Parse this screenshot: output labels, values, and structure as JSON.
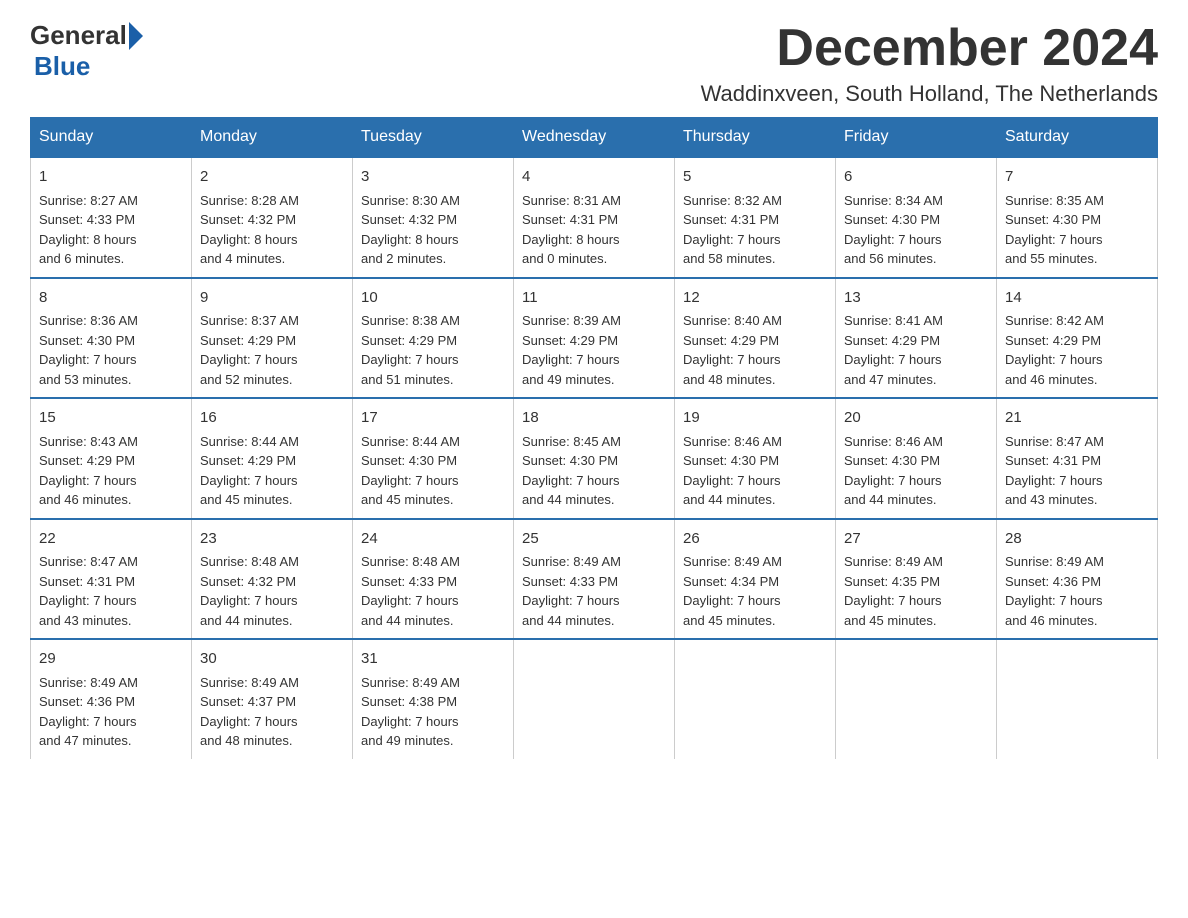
{
  "logo": {
    "general": "General",
    "blue": "Blue"
  },
  "title": "December 2024",
  "location": "Waddinxveen, South Holland, The Netherlands",
  "days_of_week": [
    "Sunday",
    "Monday",
    "Tuesday",
    "Wednesday",
    "Thursday",
    "Friday",
    "Saturday"
  ],
  "weeks": [
    [
      {
        "day": "1",
        "sunrise": "8:27 AM",
        "sunset": "4:33 PM",
        "daylight": "8 hours and 6 minutes."
      },
      {
        "day": "2",
        "sunrise": "8:28 AM",
        "sunset": "4:32 PM",
        "daylight": "8 hours and 4 minutes."
      },
      {
        "day": "3",
        "sunrise": "8:30 AM",
        "sunset": "4:32 PM",
        "daylight": "8 hours and 2 minutes."
      },
      {
        "day": "4",
        "sunrise": "8:31 AM",
        "sunset": "4:31 PM",
        "daylight": "8 hours and 0 minutes."
      },
      {
        "day": "5",
        "sunrise": "8:32 AM",
        "sunset": "4:31 PM",
        "daylight": "7 hours and 58 minutes."
      },
      {
        "day": "6",
        "sunrise": "8:34 AM",
        "sunset": "4:30 PM",
        "daylight": "7 hours and 56 minutes."
      },
      {
        "day": "7",
        "sunrise": "8:35 AM",
        "sunset": "4:30 PM",
        "daylight": "7 hours and 55 minutes."
      }
    ],
    [
      {
        "day": "8",
        "sunrise": "8:36 AM",
        "sunset": "4:30 PM",
        "daylight": "7 hours and 53 minutes."
      },
      {
        "day": "9",
        "sunrise": "8:37 AM",
        "sunset": "4:29 PM",
        "daylight": "7 hours and 52 minutes."
      },
      {
        "day": "10",
        "sunrise": "8:38 AM",
        "sunset": "4:29 PM",
        "daylight": "7 hours and 51 minutes."
      },
      {
        "day": "11",
        "sunrise": "8:39 AM",
        "sunset": "4:29 PM",
        "daylight": "7 hours and 49 minutes."
      },
      {
        "day": "12",
        "sunrise": "8:40 AM",
        "sunset": "4:29 PM",
        "daylight": "7 hours and 48 minutes."
      },
      {
        "day": "13",
        "sunrise": "8:41 AM",
        "sunset": "4:29 PM",
        "daylight": "7 hours and 47 minutes."
      },
      {
        "day": "14",
        "sunrise": "8:42 AM",
        "sunset": "4:29 PM",
        "daylight": "7 hours and 46 minutes."
      }
    ],
    [
      {
        "day": "15",
        "sunrise": "8:43 AM",
        "sunset": "4:29 PM",
        "daylight": "7 hours and 46 minutes."
      },
      {
        "day": "16",
        "sunrise": "8:44 AM",
        "sunset": "4:29 PM",
        "daylight": "7 hours and 45 minutes."
      },
      {
        "day": "17",
        "sunrise": "8:44 AM",
        "sunset": "4:30 PM",
        "daylight": "7 hours and 45 minutes."
      },
      {
        "day": "18",
        "sunrise": "8:45 AM",
        "sunset": "4:30 PM",
        "daylight": "7 hours and 44 minutes."
      },
      {
        "day": "19",
        "sunrise": "8:46 AM",
        "sunset": "4:30 PM",
        "daylight": "7 hours and 44 minutes."
      },
      {
        "day": "20",
        "sunrise": "8:46 AM",
        "sunset": "4:30 PM",
        "daylight": "7 hours and 44 minutes."
      },
      {
        "day": "21",
        "sunrise": "8:47 AM",
        "sunset": "4:31 PM",
        "daylight": "7 hours and 43 minutes."
      }
    ],
    [
      {
        "day": "22",
        "sunrise": "8:47 AM",
        "sunset": "4:31 PM",
        "daylight": "7 hours and 43 minutes."
      },
      {
        "day": "23",
        "sunrise": "8:48 AM",
        "sunset": "4:32 PM",
        "daylight": "7 hours and 44 minutes."
      },
      {
        "day": "24",
        "sunrise": "8:48 AM",
        "sunset": "4:33 PM",
        "daylight": "7 hours and 44 minutes."
      },
      {
        "day": "25",
        "sunrise": "8:49 AM",
        "sunset": "4:33 PM",
        "daylight": "7 hours and 44 minutes."
      },
      {
        "day": "26",
        "sunrise": "8:49 AM",
        "sunset": "4:34 PM",
        "daylight": "7 hours and 45 minutes."
      },
      {
        "day": "27",
        "sunrise": "8:49 AM",
        "sunset": "4:35 PM",
        "daylight": "7 hours and 45 minutes."
      },
      {
        "day": "28",
        "sunrise": "8:49 AM",
        "sunset": "4:36 PM",
        "daylight": "7 hours and 46 minutes."
      }
    ],
    [
      {
        "day": "29",
        "sunrise": "8:49 AM",
        "sunset": "4:36 PM",
        "daylight": "7 hours and 47 minutes."
      },
      {
        "day": "30",
        "sunrise": "8:49 AM",
        "sunset": "4:37 PM",
        "daylight": "7 hours and 48 minutes."
      },
      {
        "day": "31",
        "sunrise": "8:49 AM",
        "sunset": "4:38 PM",
        "daylight": "7 hours and 49 minutes."
      },
      null,
      null,
      null,
      null
    ]
  ]
}
